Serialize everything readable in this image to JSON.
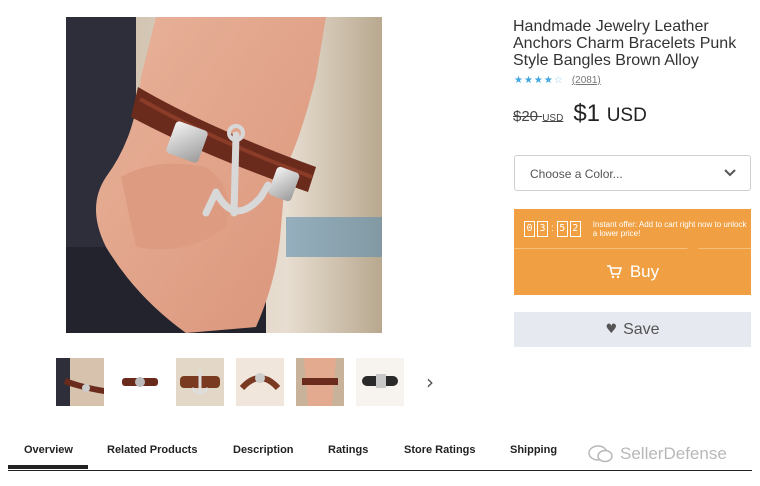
{
  "product": {
    "title": "Handmade Jewelry Leather Anchors Charm Bracelets Punk Style Bangles Brown Alloy",
    "rating_value": 4,
    "rating_max": 5,
    "review_count": "(2081)",
    "old_price": "$20",
    "old_price_currency": "USD",
    "price": "$1",
    "price_currency": "USD"
  },
  "color_select": {
    "value": "Choose a Color...",
    "icon": "chevron-down-icon"
  },
  "offer": {
    "timer_digits": [
      "0",
      "3",
      "5",
      "2"
    ],
    "timer_separator": ":",
    "text": "Instant offer: Add to cart right now to unlock a lower price!"
  },
  "buttons": {
    "buy_label": "Buy",
    "buy_icon": "cart-icon",
    "save_label": "Save",
    "save_icon": "heart-icon"
  },
  "tabs": [
    {
      "label": "Overview",
      "active": true
    },
    {
      "label": "Related Products",
      "active": false
    },
    {
      "label": "Description",
      "active": false
    },
    {
      "label": "Ratings",
      "active": false
    },
    {
      "label": "Store Ratings",
      "active": false
    },
    {
      "label": "Shipping",
      "active": false
    }
  ],
  "watermark": "SellerDefense",
  "colors": {
    "accent_orange": "#f0a042",
    "star_blue": "#41a7e0",
    "save_bg": "#e6e9ef"
  }
}
